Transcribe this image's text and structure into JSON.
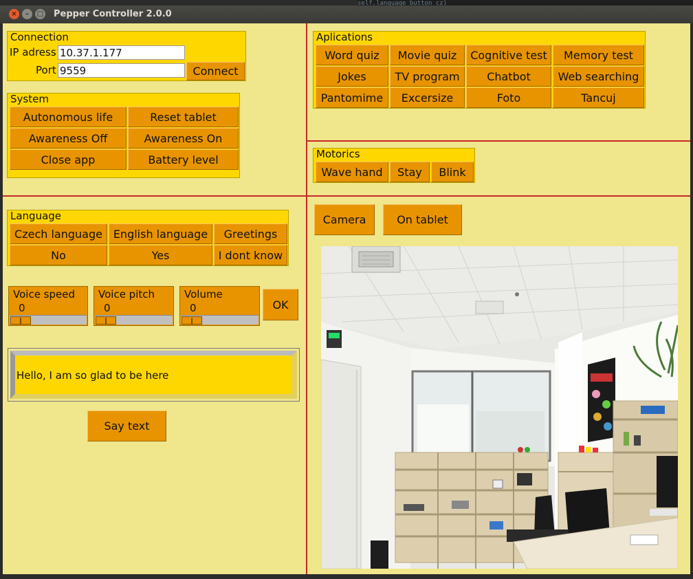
{
  "window": {
    "title": "Pepper Controller 2.0.0"
  },
  "code_strip": "self.language_button_cz)",
  "connection": {
    "title": "Connection",
    "ip_label": "IP adress",
    "ip_value": "10.37.1.177",
    "port_label": "Port",
    "port_value": "9559",
    "connect_label": "Connect"
  },
  "system": {
    "title": "System",
    "buttons": [
      "Autonomous life",
      "Reset tablet",
      "Awareness Off",
      "Awareness On",
      "Close app",
      "Battery level"
    ]
  },
  "applications": {
    "title": "Aplications",
    "buttons": [
      "Word quiz",
      "Movie quiz",
      "Cognitive test",
      "Memory test",
      "Jokes",
      "TV program",
      "Chatbot",
      "Web searching",
      "Pantomime",
      "Excersize",
      "Foto",
      "Tancuj"
    ]
  },
  "motorics": {
    "title": "Motorics",
    "buttons": [
      "Wave hand",
      "Stay",
      "Blink"
    ]
  },
  "language": {
    "title": "Language",
    "buttons": [
      "Czech language",
      "English language",
      "Greetings",
      "No",
      "Yes",
      "I dont know"
    ]
  },
  "voice": {
    "sliders": [
      {
        "label": "Voice speed",
        "value": "0"
      },
      {
        "label": "Voice pitch",
        "value": "0"
      },
      {
        "label": "Volume",
        "value": "0"
      }
    ],
    "ok_label": "OK"
  },
  "say": {
    "text": "Hello, I am so glad to be here",
    "button_label": "Say text"
  },
  "camera": {
    "camera_label": "Camera",
    "tablet_label": "On tablet"
  },
  "colors": {
    "background": "#f0e68c",
    "group": "#ffd700",
    "button": "#e89400",
    "divider": "#c62828"
  }
}
